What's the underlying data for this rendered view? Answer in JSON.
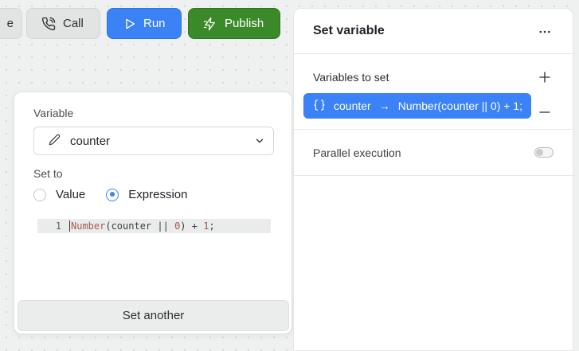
{
  "toolbar": {
    "partial_label": "e",
    "call_label": "Call",
    "run_label": "Run",
    "publish_label": "Publish"
  },
  "editor": {
    "variable_label": "Variable",
    "variable_value": "counter",
    "set_to_label": "Set to",
    "options": [
      {
        "label": "Value",
        "selected": false
      },
      {
        "label": "Expression",
        "selected": true
      }
    ],
    "code": {
      "line_number": "1",
      "tokens": [
        "Number",
        "(counter || ",
        "0",
        ") + ",
        "1",
        ";"
      ]
    },
    "set_another_label": "Set another"
  },
  "panel": {
    "title": "Set variable",
    "variables_section": "Variables to set",
    "variable_chip": {
      "name": "counter",
      "arrow": "→",
      "expression": "Number(counter || 0) + 1;"
    },
    "parallel_label": "Parallel execution",
    "parallel_enabled": false
  },
  "colors": {
    "accent": "#3b82f6",
    "publish": "#3b8a2a"
  },
  "icons": {
    "call": "phone-call-icon",
    "run": "play-icon",
    "publish": "lightning-icon",
    "variable": "pencil-icon",
    "dropdown": "chevron-down-icon",
    "chip": "braces-icon",
    "more": "more-horizontal-icon",
    "add": "plus-icon",
    "remove": "minus-icon"
  }
}
